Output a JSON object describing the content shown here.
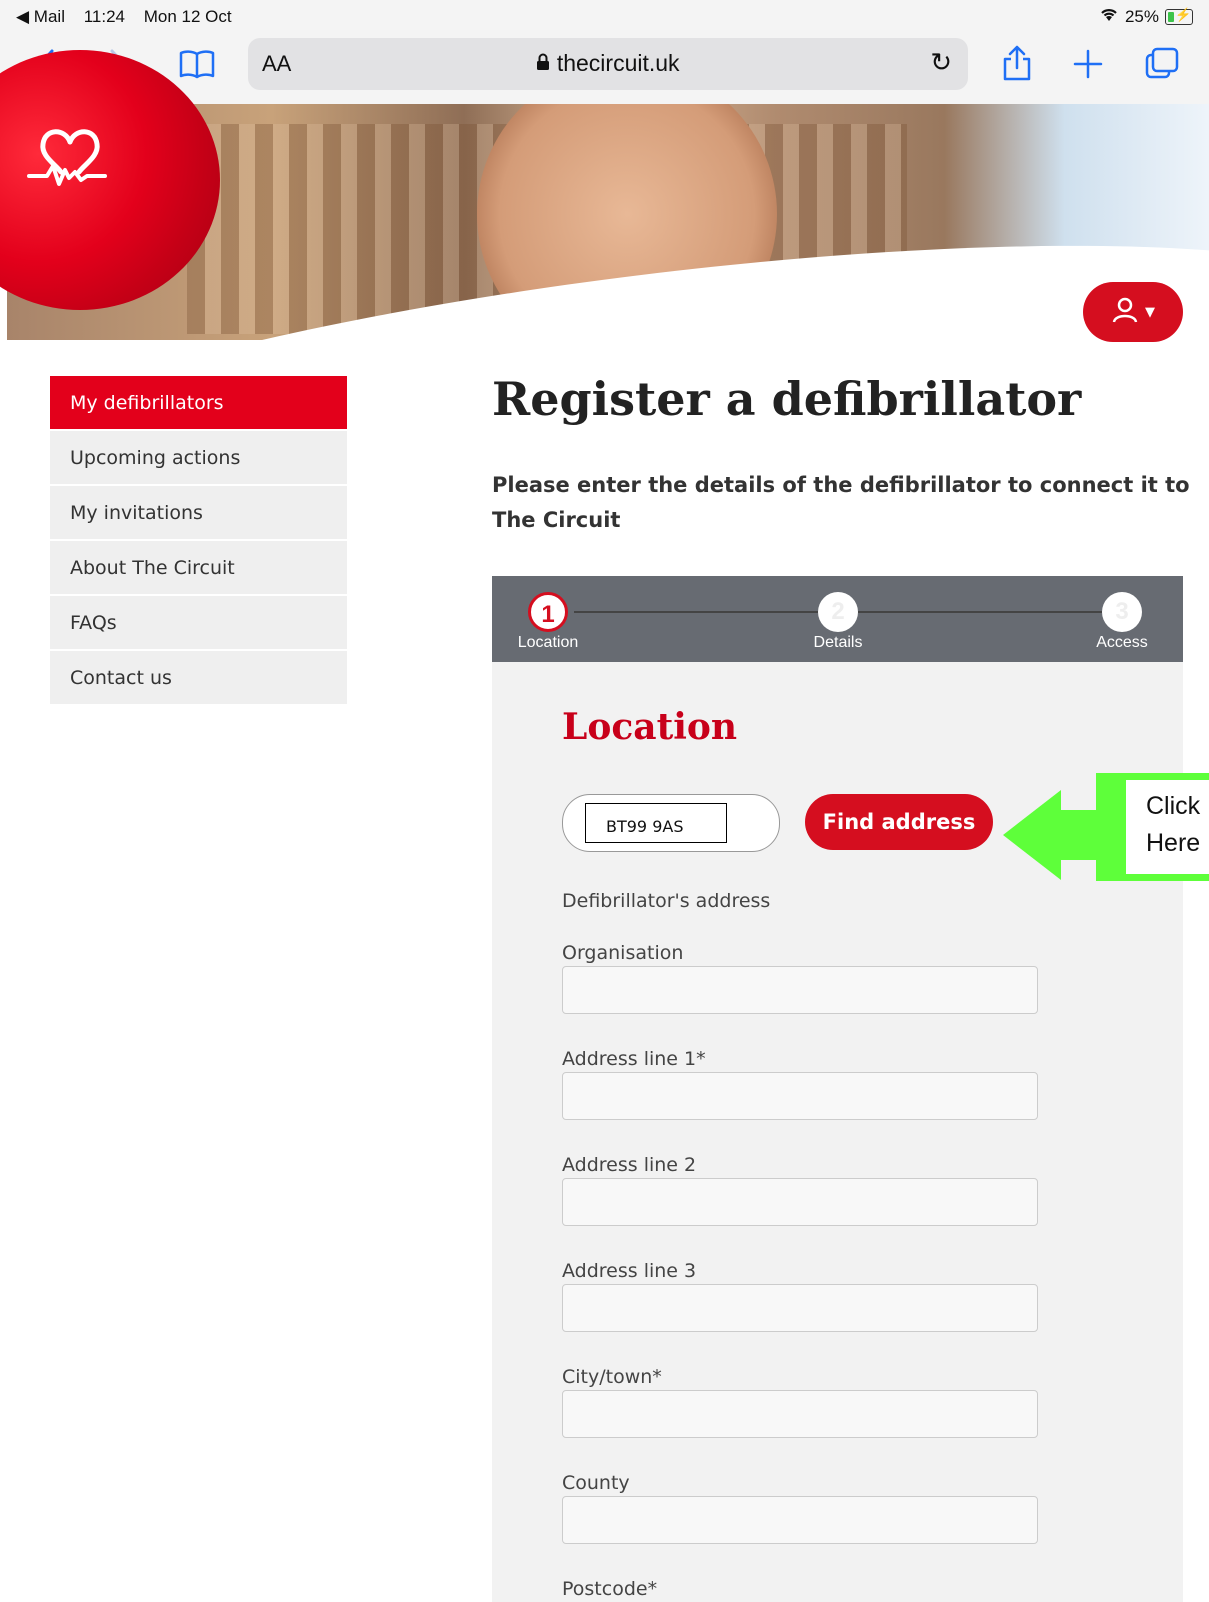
{
  "status_bar": {
    "back_app": "◀ Mail",
    "time": "11:24",
    "date": "Mon 12 Oct",
    "battery": "25%"
  },
  "browser": {
    "text_size_label": "AA",
    "url": "thecircuit.uk"
  },
  "sidebar": {
    "items": [
      {
        "label": "My defibrillators"
      },
      {
        "label": "Upcoming actions"
      },
      {
        "label": "My invitations"
      },
      {
        "label": "About The Circuit"
      },
      {
        "label": "FAQs"
      },
      {
        "label": "Contact us"
      }
    ]
  },
  "main": {
    "title": "Register a defibrillator",
    "intro": "Please enter the details of the defibrillator to connect it to The Circuit"
  },
  "steps": [
    {
      "number": "1",
      "label": "Location"
    },
    {
      "number": "2",
      "label": "Details"
    },
    {
      "number": "3",
      "label": "Access"
    }
  ],
  "form": {
    "section_title": "Location",
    "postcode_value": "BT99 9AS",
    "find_button": "Find address",
    "address_heading": "Defibrillator's address",
    "fields": [
      {
        "label": "Organisation",
        "value": ""
      },
      {
        "label": "Address line 1*",
        "value": ""
      },
      {
        "label": "Address line 2",
        "value": ""
      },
      {
        "label": "Address line 3",
        "value": ""
      },
      {
        "label": "City/town*",
        "value": ""
      },
      {
        "label": "County",
        "value": ""
      },
      {
        "label": "Postcode*",
        "value": ""
      }
    ]
  },
  "annotation": {
    "line1": "Click",
    "line2": "Here"
  },
  "colors": {
    "brand_red": "#e3001b",
    "annotation_green": "#5eff3a",
    "steps_bar": "#676b72"
  }
}
